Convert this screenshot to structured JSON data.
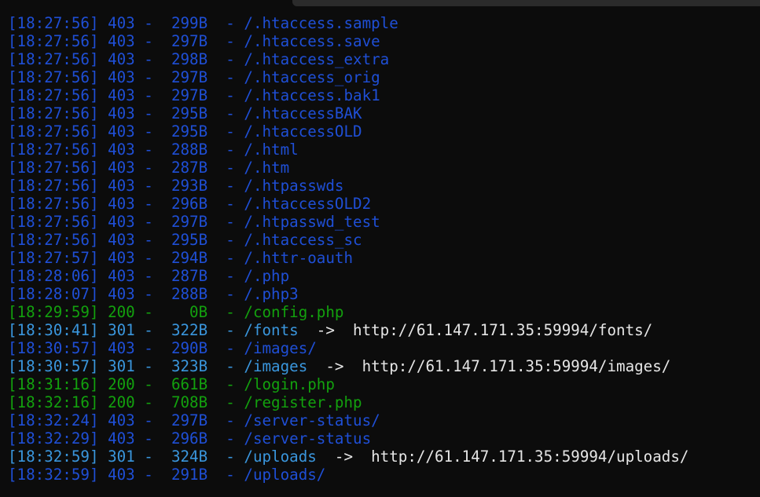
{
  "colors": {
    "background": "#0c0c0c",
    "blue": "#1f4fd6",
    "cyan": "#3a96dd",
    "green": "#13a10e",
    "white": "#e6e6e6"
  },
  "lines": [
    {
      "time": "[18:27:56]",
      "status": "403",
      "size": "299B",
      "path": "/.htaccess.sample",
      "redirect": ""
    },
    {
      "time": "[18:27:56]",
      "status": "403",
      "size": "297B",
      "path": "/.htaccess.save",
      "redirect": ""
    },
    {
      "time": "[18:27:56]",
      "status": "403",
      "size": "298B",
      "path": "/.htaccess_extra",
      "redirect": ""
    },
    {
      "time": "[18:27:56]",
      "status": "403",
      "size": "297B",
      "path": "/.htaccess_orig",
      "redirect": ""
    },
    {
      "time": "[18:27:56]",
      "status": "403",
      "size": "297B",
      "path": "/.htaccess.bak1",
      "redirect": ""
    },
    {
      "time": "[18:27:56]",
      "status": "403",
      "size": "295B",
      "path": "/.htaccessBAK",
      "redirect": ""
    },
    {
      "time": "[18:27:56]",
      "status": "403",
      "size": "295B",
      "path": "/.htaccessOLD",
      "redirect": ""
    },
    {
      "time": "[18:27:56]",
      "status": "403",
      "size": "288B",
      "path": "/.html",
      "redirect": ""
    },
    {
      "time": "[18:27:56]",
      "status": "403",
      "size": "287B",
      "path": "/.htm",
      "redirect": ""
    },
    {
      "time": "[18:27:56]",
      "status": "403",
      "size": "293B",
      "path": "/.htpasswds",
      "redirect": ""
    },
    {
      "time": "[18:27:56]",
      "status": "403",
      "size": "296B",
      "path": "/.htaccessOLD2",
      "redirect": ""
    },
    {
      "time": "[18:27:56]",
      "status": "403",
      "size": "297B",
      "path": "/.htpasswd_test",
      "redirect": ""
    },
    {
      "time": "[18:27:56]",
      "status": "403",
      "size": "295B",
      "path": "/.htaccess_sc",
      "redirect": ""
    },
    {
      "time": "[18:27:57]",
      "status": "403",
      "size": "294B",
      "path": "/.httr-oauth",
      "redirect": ""
    },
    {
      "time": "[18:28:06]",
      "status": "403",
      "size": "287B",
      "path": "/.php",
      "redirect": ""
    },
    {
      "time": "[18:28:07]",
      "status": "403",
      "size": "288B",
      "path": "/.php3",
      "redirect": ""
    },
    {
      "time": "[18:29:59]",
      "status": "200",
      "size": "0B",
      "path": "/config.php",
      "redirect": ""
    },
    {
      "time": "[18:30:41]",
      "status": "301",
      "size": "322B",
      "path": "/fonts",
      "redirect": "http://61.147.171.35:59994/fonts/"
    },
    {
      "time": "[18:30:57]",
      "status": "403",
      "size": "290B",
      "path": "/images/",
      "redirect": ""
    },
    {
      "time": "[18:30:57]",
      "status": "301",
      "size": "323B",
      "path": "/images",
      "redirect": "http://61.147.171.35:59994/images/"
    },
    {
      "time": "[18:31:16]",
      "status": "200",
      "size": "661B",
      "path": "/login.php",
      "redirect": ""
    },
    {
      "time": "[18:32:16]",
      "status": "200",
      "size": "708B",
      "path": "/register.php",
      "redirect": ""
    },
    {
      "time": "[18:32:24]",
      "status": "403",
      "size": "297B",
      "path": "/server-status/",
      "redirect": ""
    },
    {
      "time": "[18:32:29]",
      "status": "403",
      "size": "296B",
      "path": "/server-status",
      "redirect": ""
    },
    {
      "time": "[18:32:59]",
      "status": "301",
      "size": "324B",
      "path": "/uploads",
      "redirect": "http://61.147.171.35:59994/uploads/"
    },
    {
      "time": "[18:32:59]",
      "status": "403",
      "size": "291B",
      "path": "/uploads/",
      "redirect": ""
    }
  ]
}
